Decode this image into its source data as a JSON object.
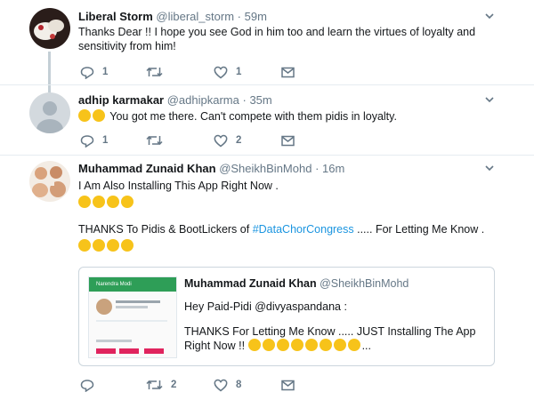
{
  "tweets": [
    {
      "name": "Liberal Storm",
      "handle": "@liberal_storm",
      "dot": "·",
      "time": "59m",
      "line1": "Thanks Dear !! I hope you see God in him too and learn the virtues of loyalty and",
      "line2": "sensitivity  from him!",
      "replies": "1",
      "retweets": "",
      "likes": "1"
    },
    {
      "name": "adhip karmakar",
      "handle": "@adhipkarma",
      "dot": "·",
      "time": "35m",
      "text": "You got me there. Can't compete with them pidis in loyalty.",
      "replies": "1",
      "retweets": "",
      "likes": "2"
    },
    {
      "name": "Muhammad Zunaid Khan",
      "handle": "@SheikhBinMohd",
      "dot": "·",
      "time": "16m",
      "line1": "I Am Also Installing This App Right Now .",
      "line3_pre": "THANKS To Pidis & BootLickers of ",
      "hashtag": "#DataChorCongress",
      "line3_post": " ..... For Letting Me Know .",
      "quote": {
        "name": "Muhammad Zunaid Khan",
        "handle": "@SheikhBinMohd",
        "line1": "Hey Paid-Pidi @divyaspandana :",
        "line2": "THANKS For Letting Me Know ..... JUST Installing The App",
        "line3_pre": "Right Now !!",
        "line3_post": "...",
        "thumb_title": "Narendra Modi"
      },
      "replies": "",
      "retweets": "2",
      "likes": "8"
    }
  ],
  "icons": {
    "reply": "reply-icon",
    "retweet": "retweet-icon",
    "like": "heart-icon",
    "dm": "envelope-icon",
    "more": "chevron-down-icon"
  },
  "colors": {
    "link": "#1b95e0",
    "muted": "#657786",
    "thread": "#c4cfd6"
  }
}
